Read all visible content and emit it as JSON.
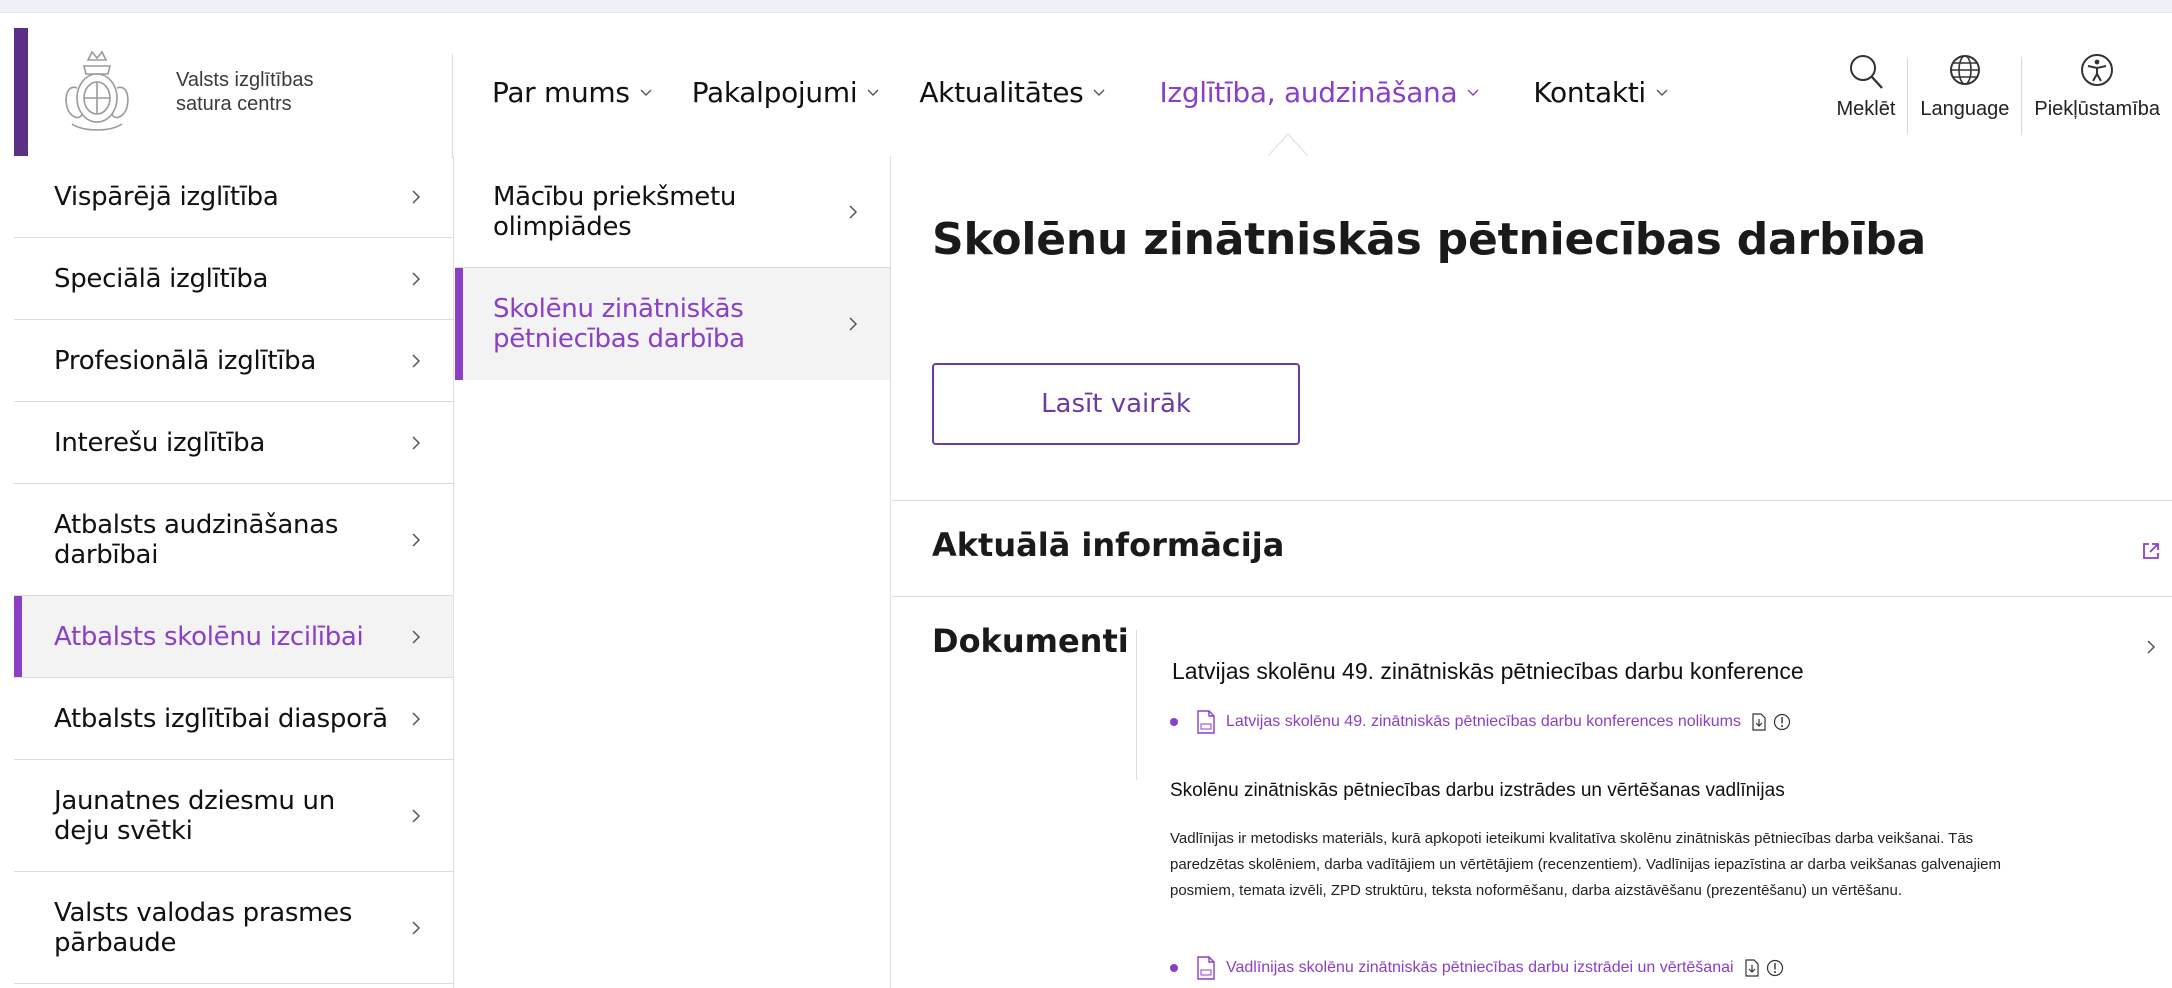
{
  "header": {
    "logo_line1": "Valsts izglītības",
    "logo_line2": "satura centrs",
    "nav": [
      {
        "label": "Par mums"
      },
      {
        "label": "Pakalpojumi"
      },
      {
        "label": "Aktualitātes"
      },
      {
        "label": "Izglītība, audzināšana",
        "active": true
      },
      {
        "label": "Kontakti"
      }
    ],
    "tools": [
      {
        "label": "Meklēt",
        "icon": "search-icon"
      },
      {
        "label": "Language",
        "icon": "globe-icon"
      },
      {
        "label": "Piekļūstamība",
        "icon": "accessibility-icon"
      }
    ],
    "accent_color": "#5b2f86",
    "active_color": "#8a3fc7"
  },
  "left_menu": [
    {
      "label": "Vispārējā izglītība"
    },
    {
      "label": "Speciālā izglītība"
    },
    {
      "label": "Profesionālā izglītība"
    },
    {
      "label": "Interešu izglītība"
    },
    {
      "label": "Atbalsts audzināšanas darbībai"
    },
    {
      "label": "Atbalsts skolēnu izcilībai",
      "active": true
    },
    {
      "label": "Atbalsts izglītībai diasporā"
    },
    {
      "label": "Jaunatnes dziesmu un deju svētki"
    },
    {
      "label": "Valsts valodas prasmes pārbaude"
    }
  ],
  "sub_menu": [
    {
      "label": "Mācību priekšmetu olimpiādes"
    },
    {
      "label": "Skolēnu zinātniskās pētniecības darbība",
      "active": true
    }
  ],
  "content": {
    "title": "Skolēnu zinātniskās pētniecības darbība",
    "read_more": "Lasīt vairāk",
    "current_info": "Aktuālā informācija",
    "documents_heading": "Dokumenti",
    "doc_group1_title": "Latvijas skolēnu 49. zinātniskās pētniecības darbu konference",
    "doc_group1_link": "Latvijas skolēnu 49. zinātniskās pētniecības darbu konferences nolikums",
    "doc_group2_title": "Skolēnu zinātniskās pētniecības darbu izstrādes un vērtēšanas vadlīnijas",
    "doc_group2_text": "Vadlīnijas ir metodisks materiāls, kurā apkopoti ieteikumi kvalitatīva skolēnu zinātniskās pētniecības darba veikšanai. Tās paredzētas skolēniem, darba vadītājiem un vērtētājiem (recenzentiem). Vadlīnijas iepazīstina ar darba veikšanas galvenajiem posmiem, temata izvēli, ZPD struktūru, teksta noformēšanu, darba aizstāvēšanu (prezentēšanu) un vērtēšanu.",
    "doc_group2_link": "Vadlīnijas skolēnu zinātniskās pētniecības darbu izstrādei un vērtēšanai"
  }
}
